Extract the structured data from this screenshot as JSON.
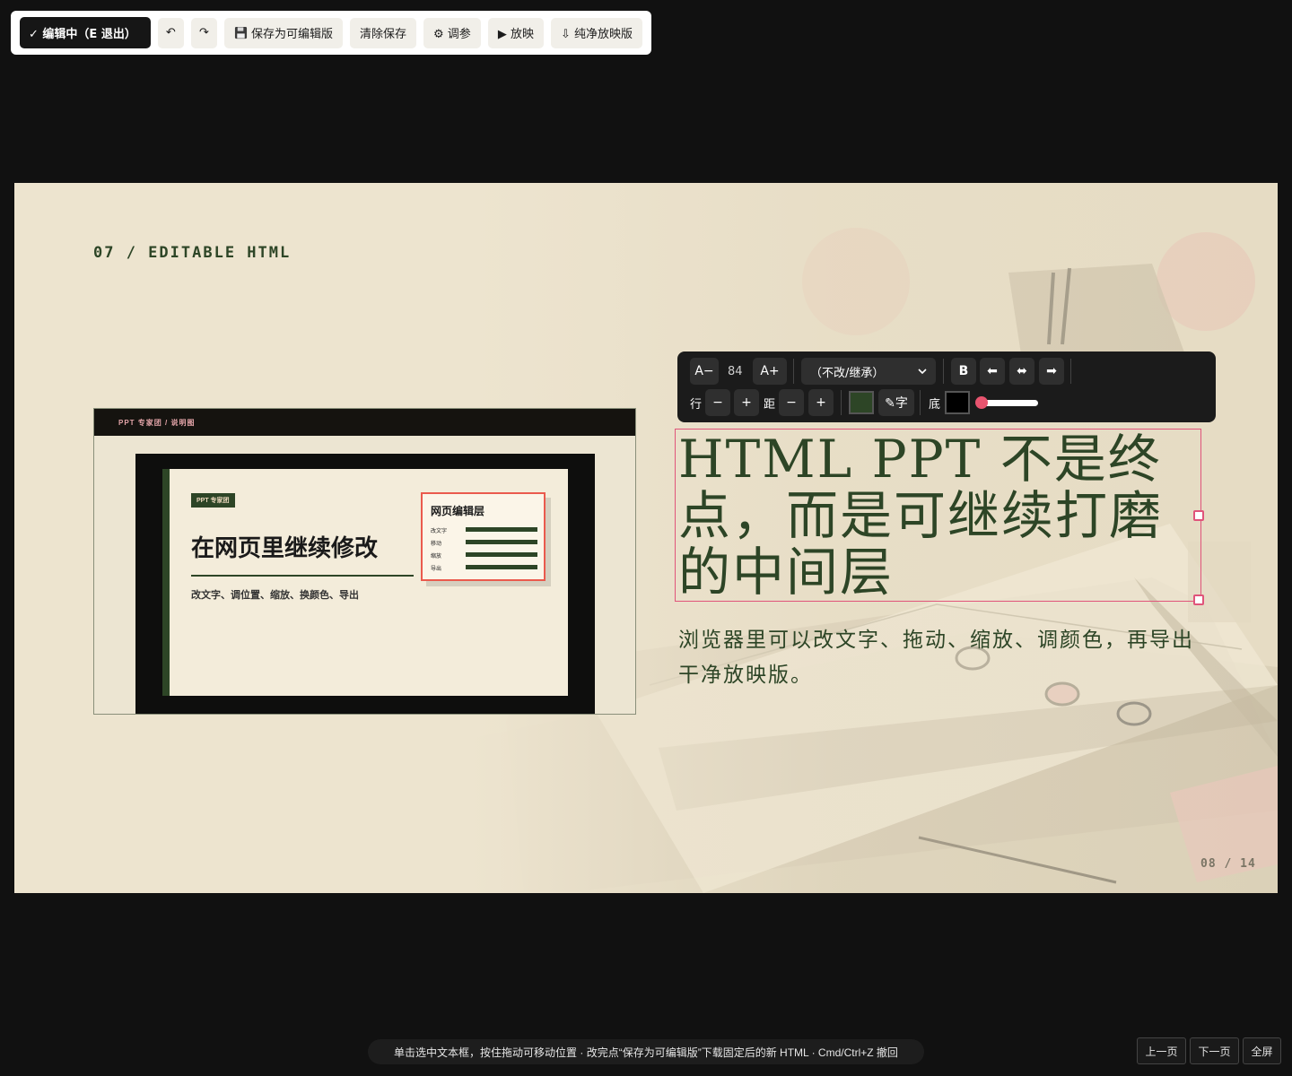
{
  "toolbar": {
    "edit_label": "✓ 编辑中（E 退出）",
    "undo_label": "↶",
    "redo_label": "↷",
    "save_label": "保存为可编辑版",
    "clear_label": "清除保存",
    "tune_label": "⚙ 调参",
    "play_label": "▶ 放映",
    "export_label": "⇩ 纯净放映版"
  },
  "slide": {
    "section_label": "07 / EDITABLE HTML",
    "page_number": "08 / 14",
    "preview": {
      "top_label": "PPT 专家团 / 说明图",
      "tag": "PPT 专家团",
      "title": "在网页里继续修改",
      "subtitle": "改文字、调位置、缩放、换颜色、导出",
      "panel_title": "网页编辑层",
      "panel_rows": [
        "改文字",
        "移动",
        "缩放",
        "导出"
      ]
    },
    "headline": "HTML PPT 不是终点，而是可继续打磨的中间层",
    "subline": "浏览器里可以改文字、拖动、缩放、调颜色，再导出干净放映版。"
  },
  "format_bar": {
    "font_smaller": "A−",
    "font_size": "84",
    "font_larger": "A+",
    "font_family": "（不改/继承）",
    "bold": "B",
    "align_left": "⬅",
    "align_center": "⬌",
    "align_right": "➡",
    "line_label": "行",
    "line_minus": "−",
    "line_plus": "+",
    "spacing_label": "距",
    "spacing_minus": "−",
    "spacing_plus": "+",
    "text_color_hex": "#2d4526",
    "text_color_label": "✎字",
    "bg_label": "底",
    "bg_color_hex": "#000000",
    "bg_opacity": 0
  },
  "hint": "单击选中文本框，按住拖动可移动位置 · 改完点“保存为可编辑版”下载固定后的新 HTML · Cmd/Ctrl+Z 撤回",
  "nav": {
    "prev": "上一页",
    "next": "下一页",
    "fullscreen": "全屏"
  },
  "colors": {
    "accent": "#2d4526",
    "slide_bg": "#ede4cf",
    "selection": "#e0547a"
  }
}
